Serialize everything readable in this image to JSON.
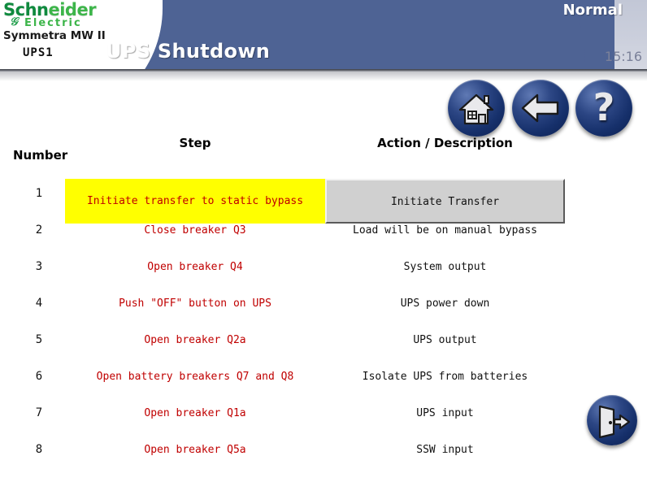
{
  "header": {
    "logo_brand_part1": "Schn",
    "logo_brand_part2": "eider",
    "logo_sub": "Electric",
    "logo_model": "Symmetra MW II",
    "unit_label": "UPS1",
    "title": "UPS Shutdown",
    "status": "Normal",
    "clock": "15:16"
  },
  "nav": {
    "home_icon": "home-icon",
    "back_icon": "back-arrow-icon",
    "help_icon": "question-mark-icon",
    "help_glyph": "?",
    "exit_icon": "exit-door-icon"
  },
  "table": {
    "headers": {
      "number": "Number",
      "step": "Step",
      "action": "Action / Description"
    },
    "rows": [
      {
        "number": "1",
        "step": "Initiate transfer to static bypass",
        "action": "Initiate Transfer",
        "active": true
      },
      {
        "number": "2",
        "step": "Close breaker Q3",
        "action": "Load will be on manual bypass",
        "active": false
      },
      {
        "number": "3",
        "step": "Open breaker Q4",
        "action": "System output",
        "active": false
      },
      {
        "number": "4",
        "step": "Push \"OFF\" button on UPS",
        "action": "UPS power down",
        "active": false
      },
      {
        "number": "5",
        "step": "Open breaker Q2a",
        "action": "UPS output",
        "active": false
      },
      {
        "number": "6",
        "step": "Open battery breakers Q7 and Q8",
        "action": "Isolate UPS from batteries",
        "active": false
      },
      {
        "number": "7",
        "step": "Open breaker Q1a",
        "action": "UPS input",
        "active": false
      },
      {
        "number": "8",
        "step": "Open breaker Q5a",
        "action": "SSW input",
        "active": false
      }
    ]
  },
  "colors": {
    "header_blue": "#4e6394",
    "header_plate": "#cbcfdc",
    "brand_green": "#3db54a",
    "step_text_red": "#c00000",
    "highlight_yellow": "#ffff00",
    "button_face_grey": "#d0d0d0",
    "nav_button_navy": "#16306b"
  }
}
